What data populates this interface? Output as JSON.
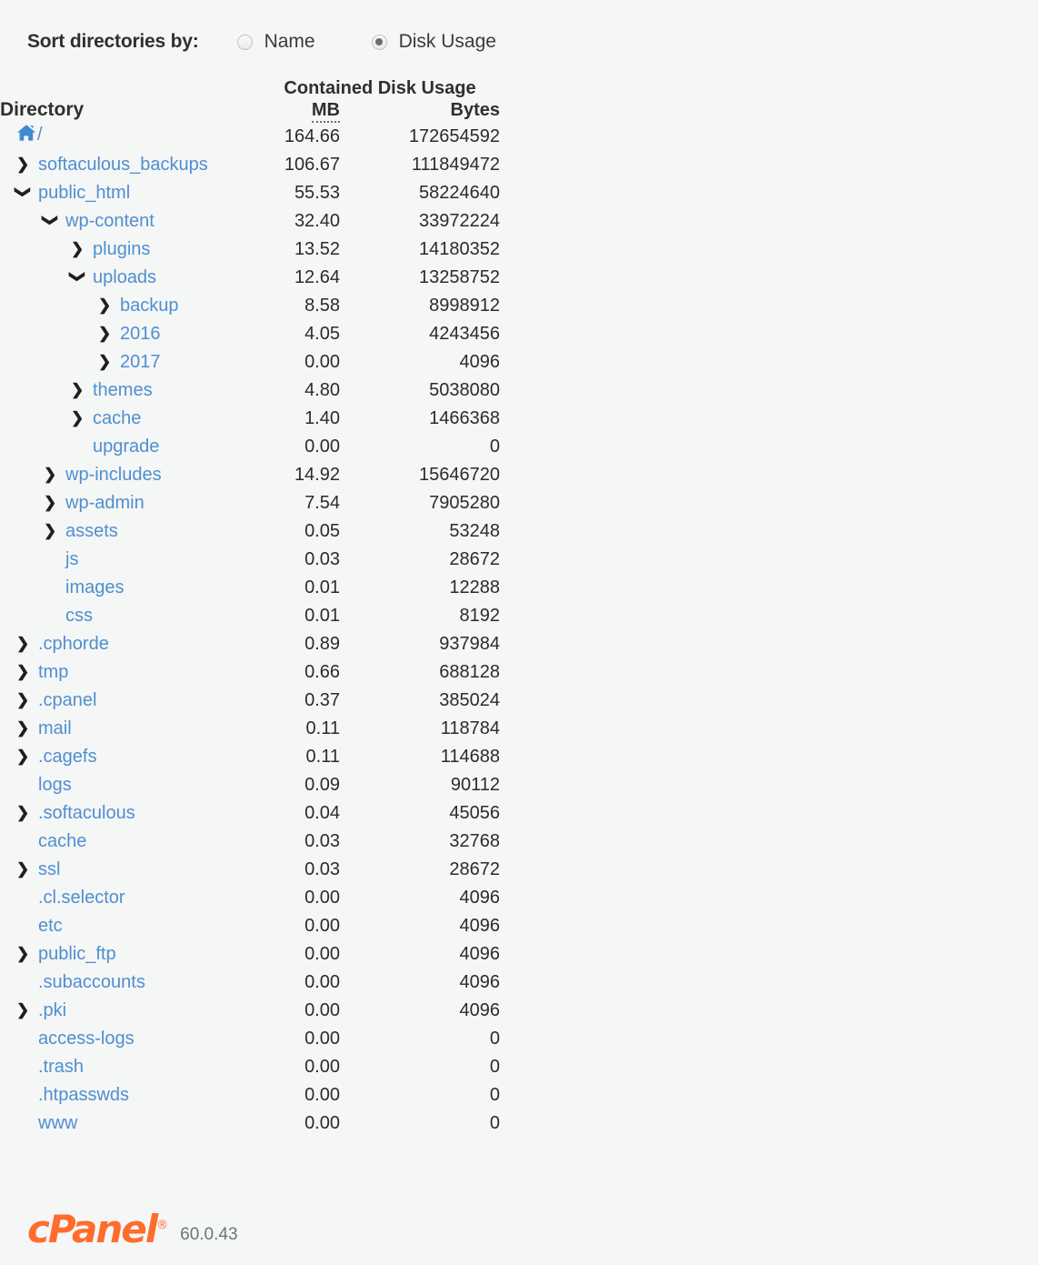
{
  "sort": {
    "label": "Sort directories by:",
    "options": [
      {
        "label": "Name",
        "checked": false
      },
      {
        "label": "Disk Usage",
        "checked": true
      }
    ]
  },
  "table": {
    "group_header": "Contained Disk Usage",
    "col_directory": "Directory",
    "col_mb": "MB",
    "col_bytes": "Bytes",
    "rows": [
      {
        "name": "/",
        "level": 0,
        "state": "home",
        "mb": "164.66",
        "bytes": "172654592"
      },
      {
        "name": "softaculous_backups",
        "level": 0,
        "state": "collapsed",
        "mb": "106.67",
        "bytes": "111849472"
      },
      {
        "name": "public_html",
        "level": 0,
        "state": "expanded",
        "mb": "55.53",
        "bytes": "58224640"
      },
      {
        "name": "wp-content",
        "level": 1,
        "state": "expanded",
        "mb": "32.40",
        "bytes": "33972224"
      },
      {
        "name": "plugins",
        "level": 2,
        "state": "collapsed",
        "mb": "13.52",
        "bytes": "14180352"
      },
      {
        "name": "uploads",
        "level": 2,
        "state": "expanded",
        "mb": "12.64",
        "bytes": "13258752"
      },
      {
        "name": "backup",
        "level": 3,
        "state": "collapsed",
        "mb": "8.58",
        "bytes": "8998912"
      },
      {
        "name": "2016",
        "level": 3,
        "state": "collapsed",
        "mb": "4.05",
        "bytes": "4243456"
      },
      {
        "name": "2017",
        "level": 3,
        "state": "collapsed",
        "mb": "0.00",
        "bytes": "4096"
      },
      {
        "name": "themes",
        "level": 2,
        "state": "collapsed",
        "mb": "4.80",
        "bytes": "5038080"
      },
      {
        "name": "cache",
        "level": 2,
        "state": "collapsed",
        "mb": "1.40",
        "bytes": "1466368"
      },
      {
        "name": "upgrade",
        "level": 2,
        "state": "leaf",
        "mb": "0.00",
        "bytes": "0"
      },
      {
        "name": "wp-includes",
        "level": 1,
        "state": "collapsed",
        "mb": "14.92",
        "bytes": "15646720"
      },
      {
        "name": "wp-admin",
        "level": 1,
        "state": "collapsed",
        "mb": "7.54",
        "bytes": "7905280"
      },
      {
        "name": "assets",
        "level": 1,
        "state": "collapsed",
        "mb": "0.05",
        "bytes": "53248"
      },
      {
        "name": "js",
        "level": 1,
        "state": "leaf",
        "mb": "0.03",
        "bytes": "28672"
      },
      {
        "name": "images",
        "level": 1,
        "state": "leaf",
        "mb": "0.01",
        "bytes": "12288"
      },
      {
        "name": "css",
        "level": 1,
        "state": "leaf",
        "mb": "0.01",
        "bytes": "8192"
      },
      {
        "name": ".cphorde",
        "level": 0,
        "state": "collapsed",
        "mb": "0.89",
        "bytes": "937984"
      },
      {
        "name": "tmp",
        "level": 0,
        "state": "collapsed",
        "mb": "0.66",
        "bytes": "688128"
      },
      {
        "name": ".cpanel",
        "level": 0,
        "state": "collapsed",
        "mb": "0.37",
        "bytes": "385024"
      },
      {
        "name": "mail",
        "level": 0,
        "state": "collapsed",
        "mb": "0.11",
        "bytes": "118784"
      },
      {
        "name": ".cagefs",
        "level": 0,
        "state": "collapsed",
        "mb": "0.11",
        "bytes": "114688"
      },
      {
        "name": "logs",
        "level": 0,
        "state": "leaf",
        "mb": "0.09",
        "bytes": "90112"
      },
      {
        "name": ".softaculous",
        "level": 0,
        "state": "collapsed",
        "mb": "0.04",
        "bytes": "45056"
      },
      {
        "name": "cache",
        "level": 0,
        "state": "leaf",
        "mb": "0.03",
        "bytes": "32768"
      },
      {
        "name": "ssl",
        "level": 0,
        "state": "collapsed",
        "mb": "0.03",
        "bytes": "28672"
      },
      {
        "name": ".cl.selector",
        "level": 0,
        "state": "leaf",
        "mb": "0.00",
        "bytes": "4096"
      },
      {
        "name": "etc",
        "level": 0,
        "state": "leaf",
        "mb": "0.00",
        "bytes": "4096"
      },
      {
        "name": "public_ftp",
        "level": 0,
        "state": "collapsed",
        "mb": "0.00",
        "bytes": "4096"
      },
      {
        "name": ".subaccounts",
        "level": 0,
        "state": "leaf",
        "mb": "0.00",
        "bytes": "4096"
      },
      {
        "name": ".pki",
        "level": 0,
        "state": "collapsed",
        "mb": "0.00",
        "bytes": "4096"
      },
      {
        "name": "access-logs",
        "level": 0,
        "state": "leaf",
        "mb": "0.00",
        "bytes": "0"
      },
      {
        "name": ".trash",
        "level": 0,
        "state": "leaf",
        "mb": "0.00",
        "bytes": "0"
      },
      {
        "name": ".htpasswds",
        "level": 0,
        "state": "leaf",
        "mb": "0.00",
        "bytes": "0"
      },
      {
        "name": "www",
        "level": 0,
        "state": "leaf",
        "mb": "0.00",
        "bytes": "0"
      }
    ]
  },
  "icons": {
    "home": "home-icon",
    "chevron_right": "chevron-right-icon",
    "chevron_down": "chevron-down-icon"
  },
  "footer": {
    "logo_text": "cPanel",
    "registered_mark": "®",
    "version": "60.0.43"
  },
  "colors": {
    "link_blue": "#4f8fd0",
    "brand_orange": "#ff6c2c",
    "background": "#f5f6f6",
    "text_dark": "#2f2f2f"
  }
}
